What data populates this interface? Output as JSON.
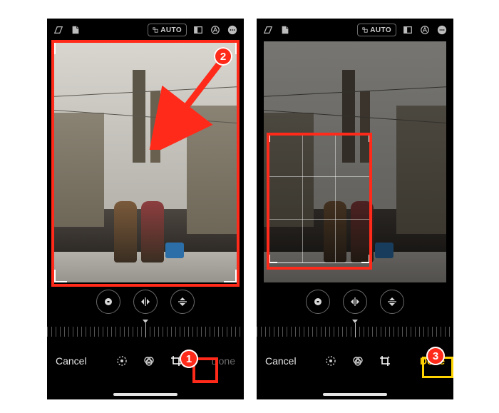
{
  "top": {
    "auto_label": "AUTO"
  },
  "bottom": {
    "cancel": "Cancel",
    "done": "Done"
  },
  "labels": {
    "step1": "1",
    "step2": "2",
    "step3": "3"
  },
  "icons": {
    "skew": "skew-icon",
    "flip_page": "flip-page-icon",
    "aspect": "aspect-ratio-icon",
    "markup": "markup-icon",
    "more": "ellipsis-circle-icon",
    "rotate": "rotate-icon",
    "flip_h": "flip-horizontal-icon",
    "flip_v": "flip-vertical-icon",
    "adjust": "adjust-icon",
    "filters": "filters-icon",
    "crop": "crop-icon"
  }
}
